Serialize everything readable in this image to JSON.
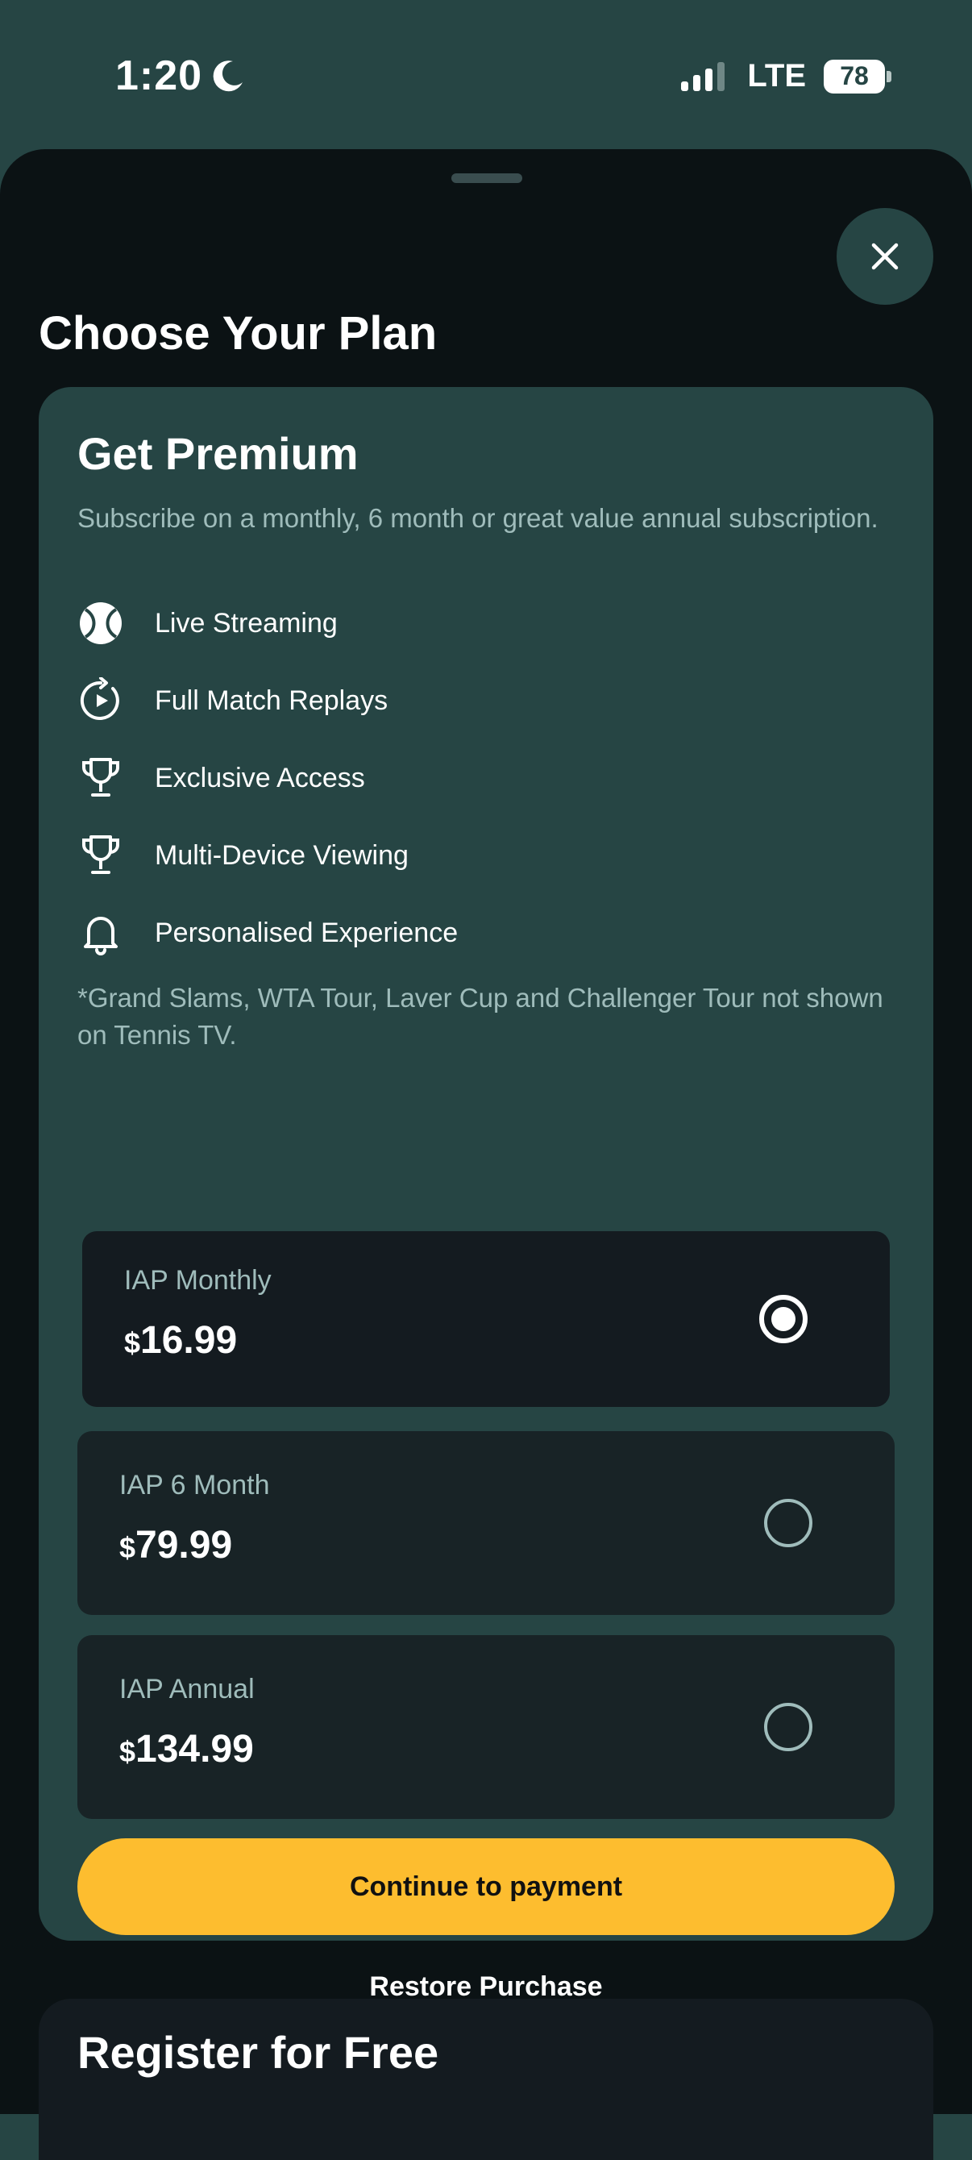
{
  "status_bar": {
    "time": "1:20",
    "network": "LTE",
    "battery": "78"
  },
  "sheet": {
    "title": "Choose Your Plan"
  },
  "premium": {
    "title": "Get Premium",
    "subtitle": "Subscribe on a monthly, 6 month or great value annual subscription.",
    "features": [
      {
        "label": "Live Streaming",
        "icon": "tennis-ball-icon"
      },
      {
        "label": "Full Match Replays",
        "icon": "replay-icon"
      },
      {
        "label": "Exclusive Access",
        "icon": "trophy-icon"
      },
      {
        "label": "Multi-Device Viewing",
        "icon": "trophy-icon"
      },
      {
        "label": "Personalised Experience",
        "icon": "bell-icon"
      }
    ],
    "disclaimer": "*Grand Slams, WTA Tour, Laver Cup and Challenger Tour not shown on Tennis TV.",
    "plans": [
      {
        "name": "IAP Monthly",
        "currency": "$",
        "amount": "16.99",
        "selected": true
      },
      {
        "name": "IAP 6 Month",
        "currency": "$",
        "amount": "79.99",
        "selected": false
      },
      {
        "name": "IAP Annual",
        "currency": "$",
        "amount": "134.99",
        "selected": false
      }
    ],
    "continue_label": "Continue to payment",
    "restore_label": "Restore Purchase"
  },
  "register": {
    "title": "Register for Free"
  },
  "colors": {
    "background": "#264544",
    "sheet": "#0b1214",
    "accent_yellow": "#fdbd2f",
    "muted_text": "#9fbcbb"
  }
}
